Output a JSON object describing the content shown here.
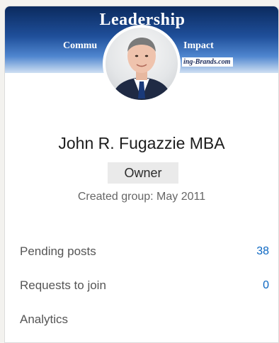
{
  "banner": {
    "title": "Leadership",
    "subtitle_left": "Commu",
    "subtitle_right": "Impact",
    "brand": "ing-Brands.com"
  },
  "profile": {
    "name": "John R. Fugazzie MBA",
    "role_badge": "Owner",
    "created": "Created group: May 2011"
  },
  "stats": [
    {
      "label": "Pending posts",
      "count": "38"
    },
    {
      "label": "Requests to join",
      "count": "0"
    },
    {
      "label": "Analytics"
    }
  ],
  "colors": {
    "accent": "#0a66c2",
    "banner_dark": "#0b2a5e",
    "badge_bg": "#eaeaea"
  }
}
